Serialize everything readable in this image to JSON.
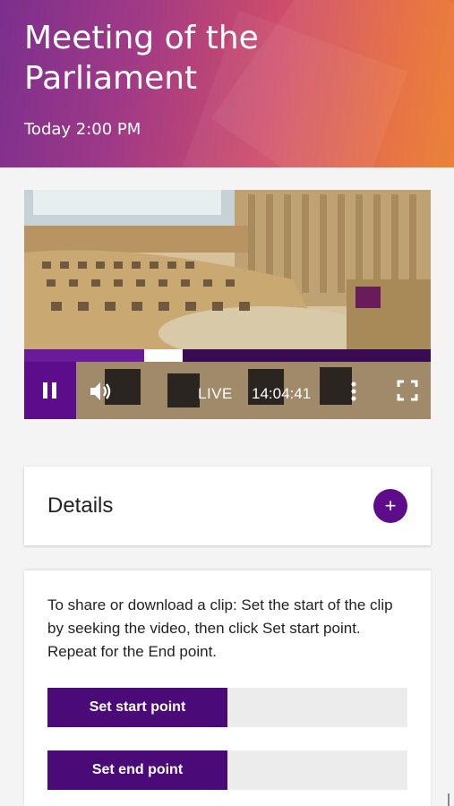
{
  "header": {
    "title": "Meeting of the Parliament",
    "datetime": "Today 2:00 PM"
  },
  "player": {
    "live_label": "LIVE",
    "time_display": "14:04:41",
    "progress": {
      "played_fraction": 0.295,
      "buffer_end_fraction": 0.39
    },
    "icons": {
      "pause": "pause-icon",
      "volume": "volume-icon",
      "more": "more-vertical-icon",
      "fullscreen": "fullscreen-icon"
    }
  },
  "details": {
    "label": "Details",
    "expand_icon": "plus-icon",
    "expand_symbol": "+"
  },
  "clip": {
    "instructions": "To share or download a clip: Set the start of the clip by seeking the video, then click Set start point. Repeat for the End point.",
    "start_button": "Set start point",
    "start_value": "",
    "end_button": "Set end point",
    "end_value": ""
  },
  "colors": {
    "accent": "#5d0c8b",
    "header_gradient_start": "#7b2f8e",
    "header_gradient_end": "#ea7a2c"
  }
}
